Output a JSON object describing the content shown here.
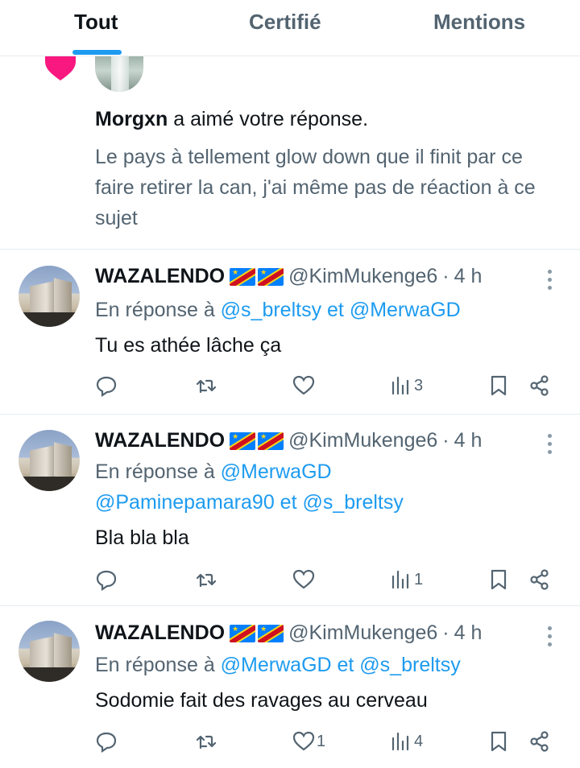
{
  "tabs": [
    {
      "label": "Tout",
      "active": true
    },
    {
      "label": "Certifié",
      "active": false
    },
    {
      "label": "Mentions",
      "active": false
    }
  ],
  "notification": {
    "user": "Morgxn",
    "action": "a aimé votre réponse.",
    "quote": "Le pays à tellement glow down que il finit par ce faire retirer la can, j'ai même pas de réaction à ce sujet"
  },
  "tweets": [
    {
      "name": "WAZALENDO",
      "handle": "@KimMukenge6",
      "dot": "·",
      "time": "4 h",
      "reply_prefix": "En réponse à",
      "reply_line1": "@s_breltsy et @MerwaGD",
      "reply_line2": "",
      "text": "Tu es athée  lâche  ça",
      "likes": "",
      "views": "3"
    },
    {
      "name": "WAZALENDO",
      "handle": "@KimMukenge6",
      "dot": "·",
      "time": "4 h",
      "reply_prefix": "En réponse à",
      "reply_line1": "@MerwaGD",
      "reply_line2": "@Paminepamara90 et @s_breltsy",
      "text": "Bla bla bla",
      "likes": "",
      "views": "1"
    },
    {
      "name": "WAZALENDO",
      "handle": "@KimMukenge6",
      "dot": "·",
      "time": "4 h",
      "reply_prefix": "En réponse à",
      "reply_line1": "@MerwaGD et @s_breltsy",
      "reply_line2": "",
      "text": "Sodomie fait des ravages au cerveau",
      "likes": "1",
      "views": "4"
    }
  ],
  "colors": {
    "accent": "#1d9bf0",
    "secondary_text": "#536471",
    "heart": "#f91880"
  },
  "icons": [
    "heart-icon",
    "reply-icon",
    "retweet-icon",
    "like-icon",
    "views-icon",
    "bookmark-icon",
    "share-icon",
    "more-icon"
  ]
}
